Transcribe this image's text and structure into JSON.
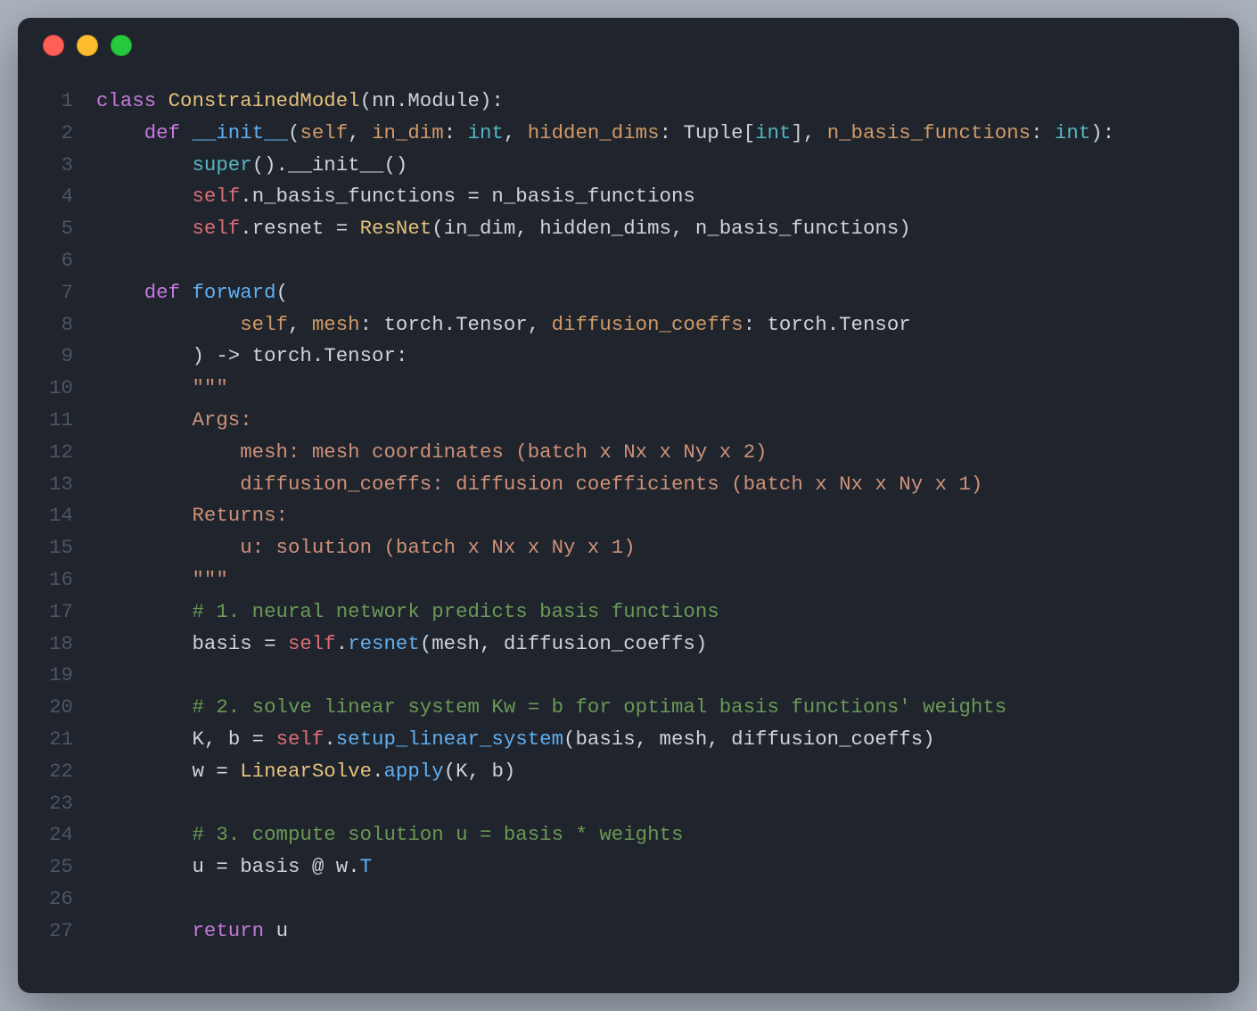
{
  "window": {
    "traffic_light": {
      "red": "#ff5f56",
      "yellow": "#ffbd2e",
      "green": "#27c93f"
    }
  },
  "code": {
    "language": "python",
    "lines": [
      {
        "n": 1,
        "indent": 0,
        "tokens": [
          {
            "t": "class ",
            "c": "kw"
          },
          {
            "t": "ConstrainedModel",
            "c": "cls"
          },
          {
            "t": "(",
            "c": "punc"
          },
          {
            "t": "nn",
            "c": "ghost"
          },
          {
            "t": ".",
            "c": "punc"
          },
          {
            "t": "Module",
            "c": "ghost"
          },
          {
            "t": "):",
            "c": "punc"
          }
        ]
      },
      {
        "n": 2,
        "indent": 1,
        "tokens": [
          {
            "t": "def ",
            "c": "kw"
          },
          {
            "t": "__init__",
            "c": "dunder"
          },
          {
            "t": "(",
            "c": "punc"
          },
          {
            "t": "self",
            "c": "param"
          },
          {
            "t": ", ",
            "c": "punc"
          },
          {
            "t": "in_dim",
            "c": "param"
          },
          {
            "t": ": ",
            "c": "punc"
          },
          {
            "t": "int",
            "c": "type"
          },
          {
            "t": ", ",
            "c": "punc"
          },
          {
            "t": "hidden_dims",
            "c": "param"
          },
          {
            "t": ": ",
            "c": "punc"
          },
          {
            "t": "Tuple",
            "c": "ghost"
          },
          {
            "t": "[",
            "c": "punc"
          },
          {
            "t": "int",
            "c": "type"
          },
          {
            "t": "]",
            "c": "punc"
          },
          {
            "t": ", ",
            "c": "punc"
          },
          {
            "t": "n_basis_functions",
            "c": "param"
          },
          {
            "t": ": ",
            "c": "punc"
          },
          {
            "t": "int",
            "c": "type"
          },
          {
            "t": "):",
            "c": "punc"
          }
        ]
      },
      {
        "n": 3,
        "indent": 2,
        "tokens": [
          {
            "t": "super",
            "c": "super"
          },
          {
            "t": "().",
            "c": "punc"
          },
          {
            "t": "__init__",
            "c": "ghost"
          },
          {
            "t": "()",
            "c": "punc"
          }
        ]
      },
      {
        "n": 4,
        "indent": 2,
        "tokens": [
          {
            "t": "self",
            "c": "self"
          },
          {
            "t": ".",
            "c": "punc"
          },
          {
            "t": "n_basis_functions",
            "c": "ghost"
          },
          {
            "t": " = ",
            "c": "punc"
          },
          {
            "t": "n_basis_functions",
            "c": "ghost"
          }
        ]
      },
      {
        "n": 5,
        "indent": 2,
        "tokens": [
          {
            "t": "self",
            "c": "self"
          },
          {
            "t": ".",
            "c": "punc"
          },
          {
            "t": "resnet",
            "c": "ghost"
          },
          {
            "t": " = ",
            "c": "punc"
          },
          {
            "t": "ResNet",
            "c": "cls"
          },
          {
            "t": "(",
            "c": "punc"
          },
          {
            "t": "in_dim",
            "c": "ghost"
          },
          {
            "t": ", ",
            "c": "punc"
          },
          {
            "t": "hidden_dims",
            "c": "ghost"
          },
          {
            "t": ", ",
            "c": "punc"
          },
          {
            "t": "n_basis_functions",
            "c": "ghost"
          },
          {
            "t": ")",
            "c": "punc"
          }
        ]
      },
      {
        "n": 6,
        "indent": 0,
        "tokens": []
      },
      {
        "n": 7,
        "indent": 1,
        "tokens": [
          {
            "t": "def ",
            "c": "kw"
          },
          {
            "t": "forward",
            "c": "fn"
          },
          {
            "t": "(",
            "c": "punc"
          }
        ]
      },
      {
        "n": 8,
        "indent": 3,
        "tokens": [
          {
            "t": "self",
            "c": "param"
          },
          {
            "t": ", ",
            "c": "punc"
          },
          {
            "t": "mesh",
            "c": "param"
          },
          {
            "t": ": ",
            "c": "punc"
          },
          {
            "t": "torch",
            "c": "ghost"
          },
          {
            "t": ".",
            "c": "punc"
          },
          {
            "t": "Tensor",
            "c": "ghost"
          },
          {
            "t": ", ",
            "c": "punc"
          },
          {
            "t": "diffusion_coeffs",
            "c": "param"
          },
          {
            "t": ": ",
            "c": "punc"
          },
          {
            "t": "torch",
            "c": "ghost"
          },
          {
            "t": ".",
            "c": "punc"
          },
          {
            "t": "Tensor",
            "c": "ghost"
          }
        ]
      },
      {
        "n": 9,
        "indent": 2,
        "tokens": [
          {
            "t": ") -> ",
            "c": "punc"
          },
          {
            "t": "torch",
            "c": "ghost"
          },
          {
            "t": ".",
            "c": "punc"
          },
          {
            "t": "Tensor",
            "c": "ghost"
          },
          {
            "t": ":",
            "c": "punc"
          }
        ]
      },
      {
        "n": 10,
        "indent": 2,
        "tokens": [
          {
            "t": "\"\"\"",
            "c": "doc"
          }
        ]
      },
      {
        "n": 11,
        "indent": 2,
        "tokens": [
          {
            "t": "Args:",
            "c": "doc"
          }
        ]
      },
      {
        "n": 12,
        "indent": 3,
        "tokens": [
          {
            "t": "mesh: mesh coordinates (batch x Nx x Ny x 2)",
            "c": "doc"
          }
        ]
      },
      {
        "n": 13,
        "indent": 3,
        "tokens": [
          {
            "t": "diffusion_coeffs: diffusion coefficients (batch x Nx x Ny x 1)",
            "c": "doc"
          }
        ]
      },
      {
        "n": 14,
        "indent": 2,
        "tokens": [
          {
            "t": "Returns:",
            "c": "doc"
          }
        ]
      },
      {
        "n": 15,
        "indent": 3,
        "tokens": [
          {
            "t": "u: solution (batch x Nx x Ny x 1)",
            "c": "doc"
          }
        ]
      },
      {
        "n": 16,
        "indent": 2,
        "tokens": [
          {
            "t": "\"\"\"",
            "c": "doc"
          }
        ]
      },
      {
        "n": 17,
        "indent": 2,
        "tokens": [
          {
            "t": "# 1. neural network predicts basis functions",
            "c": "comment"
          }
        ]
      },
      {
        "n": 18,
        "indent": 2,
        "tokens": [
          {
            "t": "basis",
            "c": "ghost"
          },
          {
            "t": " = ",
            "c": "punc"
          },
          {
            "t": "self",
            "c": "self"
          },
          {
            "t": ".",
            "c": "punc"
          },
          {
            "t": "resnet",
            "c": "fn"
          },
          {
            "t": "(",
            "c": "punc"
          },
          {
            "t": "mesh",
            "c": "ghost"
          },
          {
            "t": ", ",
            "c": "punc"
          },
          {
            "t": "diffusion_coeffs",
            "c": "ghost"
          },
          {
            "t": ")",
            "c": "punc"
          }
        ]
      },
      {
        "n": 19,
        "indent": 0,
        "tokens": []
      },
      {
        "n": 20,
        "indent": 2,
        "tokens": [
          {
            "t": "# 2. solve linear system Kw = b for optimal basis functions' weights",
            "c": "comment"
          }
        ]
      },
      {
        "n": 21,
        "indent": 2,
        "tokens": [
          {
            "t": "K",
            "c": "ghost"
          },
          {
            "t": ", ",
            "c": "punc"
          },
          {
            "t": "b",
            "c": "ghost"
          },
          {
            "t": " = ",
            "c": "punc"
          },
          {
            "t": "self",
            "c": "self"
          },
          {
            "t": ".",
            "c": "punc"
          },
          {
            "t": "setup_linear_system",
            "c": "fn"
          },
          {
            "t": "(",
            "c": "punc"
          },
          {
            "t": "basis",
            "c": "ghost"
          },
          {
            "t": ", ",
            "c": "punc"
          },
          {
            "t": "mesh",
            "c": "ghost"
          },
          {
            "t": ", ",
            "c": "punc"
          },
          {
            "t": "diffusion_coeffs",
            "c": "ghost"
          },
          {
            "t": ")",
            "c": "punc"
          }
        ]
      },
      {
        "n": 22,
        "indent": 2,
        "tokens": [
          {
            "t": "w",
            "c": "ghost"
          },
          {
            "t": " = ",
            "c": "punc"
          },
          {
            "t": "LinearSolve",
            "c": "cls"
          },
          {
            "t": ".",
            "c": "punc"
          },
          {
            "t": "apply",
            "c": "fn"
          },
          {
            "t": "(",
            "c": "punc"
          },
          {
            "t": "K",
            "c": "ghost"
          },
          {
            "t": ", ",
            "c": "punc"
          },
          {
            "t": "b",
            "c": "ghost"
          },
          {
            "t": ")",
            "c": "punc"
          }
        ]
      },
      {
        "n": 23,
        "indent": 0,
        "tokens": []
      },
      {
        "n": 24,
        "indent": 2,
        "tokens": [
          {
            "t": "# 3. compute solution u = basis * weights",
            "c": "comment"
          }
        ]
      },
      {
        "n": 25,
        "indent": 2,
        "tokens": [
          {
            "t": "u",
            "c": "ghost"
          },
          {
            "t": " = ",
            "c": "punc"
          },
          {
            "t": "basis",
            "c": "ghost"
          },
          {
            "t": " @ ",
            "c": "punc"
          },
          {
            "t": "w",
            "c": "ghost"
          },
          {
            "t": ".",
            "c": "punc"
          },
          {
            "t": "T",
            "c": "fn"
          }
        ]
      },
      {
        "n": 26,
        "indent": 0,
        "tokens": []
      },
      {
        "n": 27,
        "indent": 2,
        "tokens": [
          {
            "t": "return ",
            "c": "kw"
          },
          {
            "t": "u",
            "c": "ghost"
          }
        ]
      }
    ]
  }
}
